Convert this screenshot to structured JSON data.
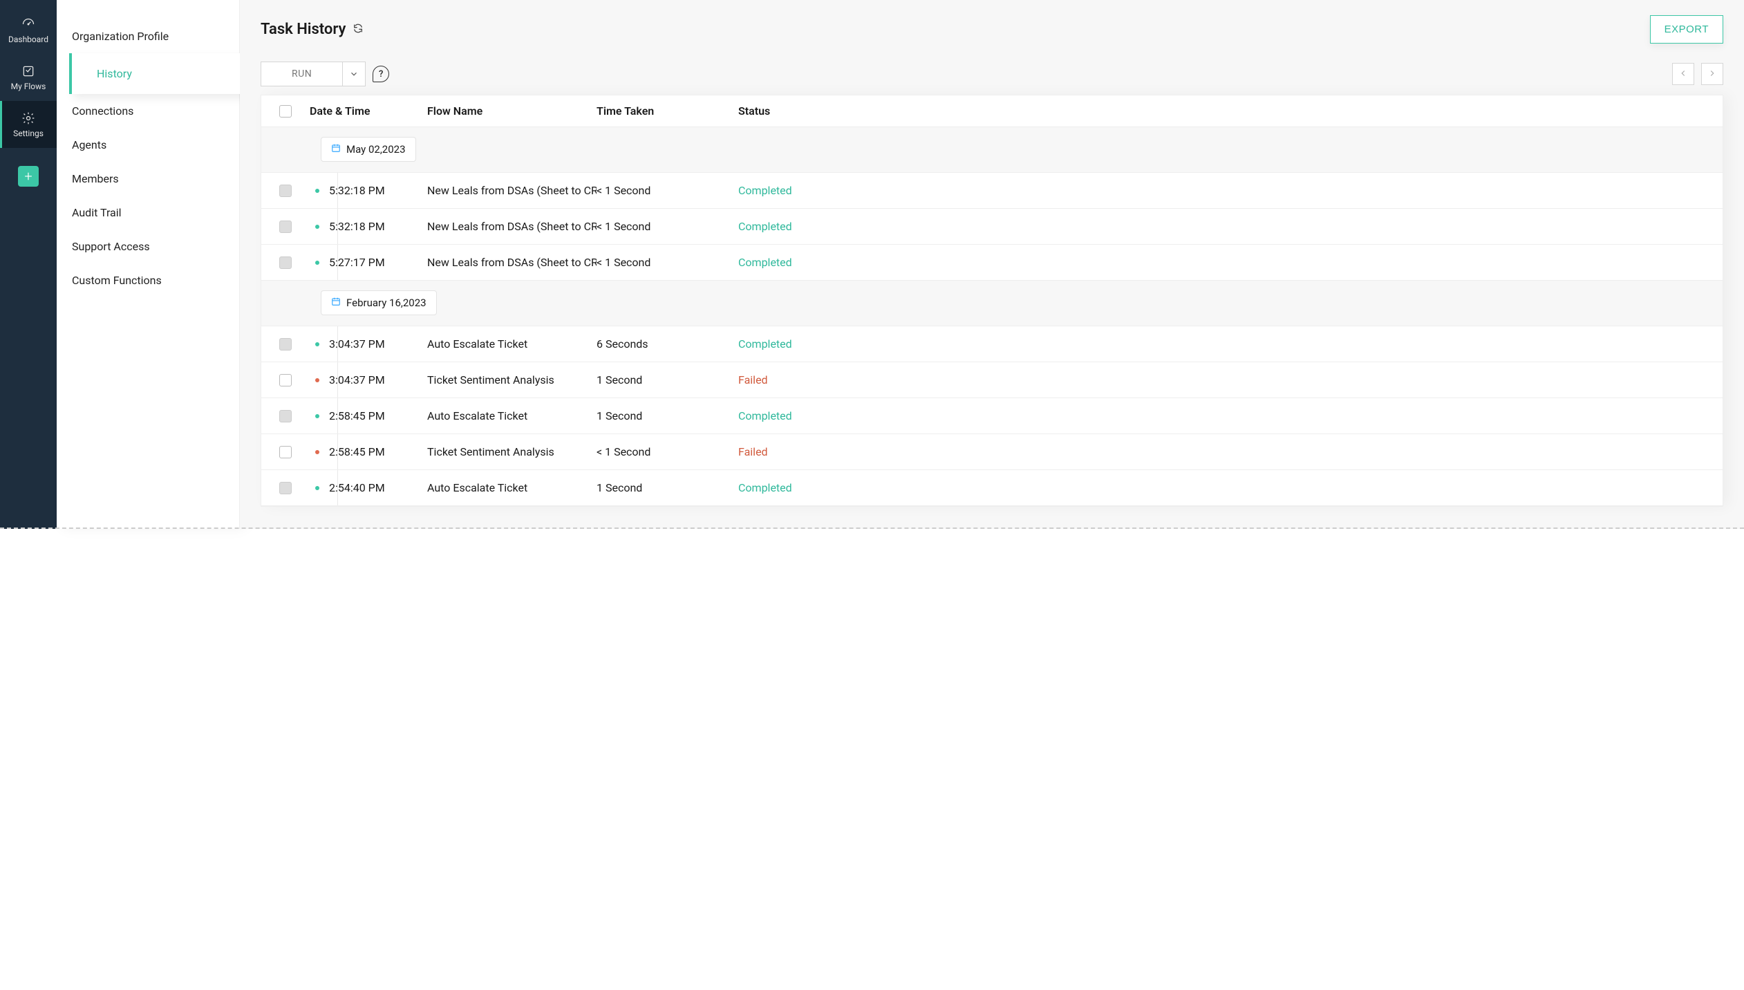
{
  "rail": {
    "items": [
      {
        "label": "Dashboard",
        "icon": "gauge-icon",
        "active": false
      },
      {
        "label": "My Flows",
        "icon": "flow-icon",
        "active": false
      },
      {
        "label": "Settings",
        "icon": "gear-icon",
        "active": true
      }
    ]
  },
  "sidebar": {
    "items": [
      {
        "label": "Organization Profile",
        "sub": [
          {
            "label": "History",
            "active": true
          }
        ]
      },
      {
        "label": "Connections"
      },
      {
        "label": "Agents"
      },
      {
        "label": "Members"
      },
      {
        "label": "Audit Trail"
      },
      {
        "label": "Support Access"
      },
      {
        "label": "Custom Functions"
      }
    ]
  },
  "header": {
    "title": "Task History",
    "export_label": "EXPORT"
  },
  "toolbar": {
    "run_label": "RUN",
    "help_label": "?"
  },
  "table": {
    "columns": {
      "date_time": "Date & Time",
      "flow_name": "Flow Name",
      "time_taken": "Time Taken",
      "status": "Status"
    },
    "groups": [
      {
        "date": "May 02,2023",
        "rows": [
          {
            "time": "5:32:18 PM",
            "flow": "New Leals from DSAs (Sheet to CRM)",
            "taken": "< 1 Second",
            "status": "Completed",
            "checkFilled": true
          },
          {
            "time": "5:32:18 PM",
            "flow": "New Leals from DSAs (Sheet to CRM)",
            "taken": "< 1 Second",
            "status": "Completed",
            "checkFilled": true
          },
          {
            "time": "5:27:17 PM",
            "flow": "New Leals from DSAs (Sheet to CRM)",
            "taken": "< 1 Second",
            "status": "Completed",
            "checkFilled": true
          }
        ]
      },
      {
        "date": "February 16,2023",
        "rows": [
          {
            "time": "3:04:37 PM",
            "flow": "Auto Escalate Ticket",
            "taken": "6 Seconds",
            "status": "Completed",
            "checkFilled": true
          },
          {
            "time": "3:04:37 PM",
            "flow": "Ticket Sentiment Analysis",
            "taken": "1 Second",
            "status": "Failed",
            "checkFilled": false
          },
          {
            "time": "2:58:45 PM",
            "flow": "Auto Escalate Ticket",
            "taken": "1 Second",
            "status": "Completed",
            "checkFilled": true
          },
          {
            "time": "2:58:45 PM",
            "flow": "Ticket Sentiment Analysis",
            "taken": "< 1 Second",
            "status": "Failed",
            "checkFilled": false
          },
          {
            "time": "2:54:40 PM",
            "flow": "Auto Escalate Ticket",
            "taken": "1 Second",
            "status": "Completed",
            "checkFilled": true
          }
        ]
      }
    ]
  },
  "colors": {
    "accent": "#3cc7a6",
    "fail": "#d15a3d"
  }
}
